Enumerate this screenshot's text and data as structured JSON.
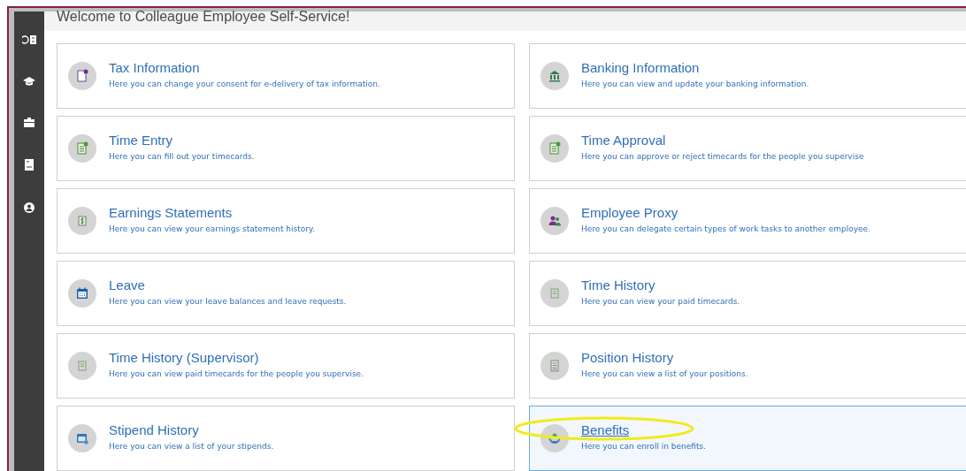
{
  "header": {
    "title": "Welcome to Colleague Employee Self-Service!"
  },
  "cards": [
    {
      "title": "Tax Information",
      "description": "Here you can change your consent for e-delivery of tax information.",
      "kind": "tax",
      "selected": false
    },
    {
      "title": "Banking Information",
      "description": "Here you can view and update your banking information.",
      "kind": "bank",
      "selected": false
    },
    {
      "title": "Time Entry",
      "description": "Here you can fill out your timecards.",
      "kind": "timesheet",
      "selected": false
    },
    {
      "title": "Time Approval",
      "description": "Here you can approve or reject timecards for the people you supervise",
      "kind": "timesheet",
      "selected": false
    },
    {
      "title": "Earnings Statements",
      "description": "Here you can view your earnings statement history.",
      "kind": "dollar",
      "selected": false
    },
    {
      "title": "Employee Proxy",
      "description": "Here you can delegate certain types of work tasks to another employee.",
      "kind": "people",
      "selected": false
    },
    {
      "title": "Leave",
      "description": "Here you can view your leave balances and leave requests.",
      "kind": "calendar",
      "selected": false
    },
    {
      "title": "Time History",
      "description": "Here you can view your paid timecards.",
      "kind": "history",
      "selected": false
    },
    {
      "title": "Time History (Supervisor)",
      "description": "Here you can view paid timecards for the people you supervise.",
      "kind": "history",
      "selected": false
    },
    {
      "title": "Position History",
      "description": "Here you can view a list of your positions.",
      "kind": "list",
      "selected": false
    },
    {
      "title": "Stipend History",
      "description": "Here you can view a list of your stipends.",
      "kind": "stipend",
      "selected": false
    },
    {
      "title": "Benefits",
      "description": "Here you can enroll in benefits.",
      "kind": "benefits",
      "selected": true
    }
  ]
}
